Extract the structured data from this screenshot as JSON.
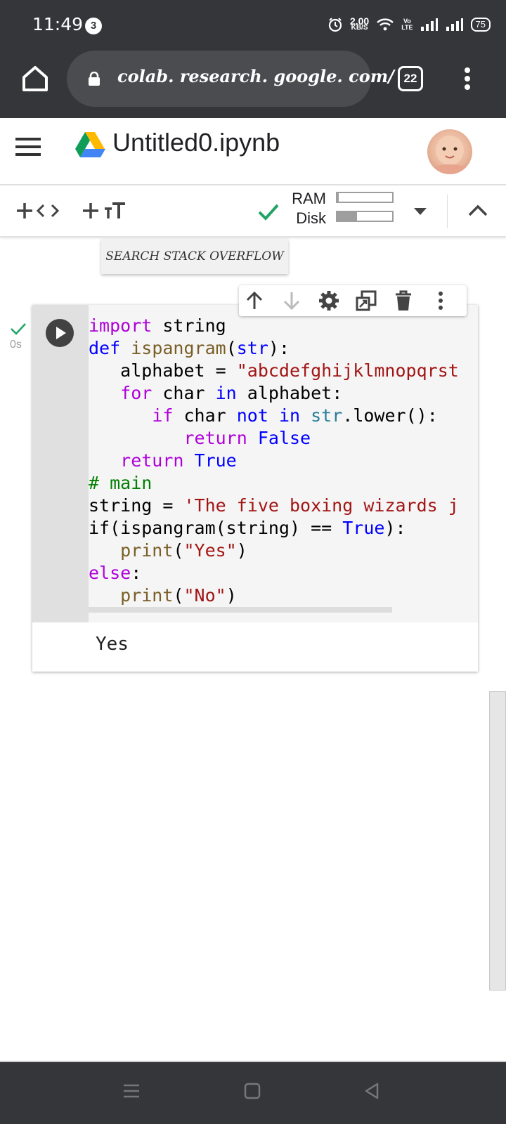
{
  "status_bar": {
    "time": "11:49",
    "notification_count": "3",
    "net_speed_value": "2.00",
    "net_speed_unit": "KB/S",
    "volte_top": "Vo",
    "volte_bottom": "LTE",
    "battery": "75"
  },
  "browser": {
    "url": "colab. research. google. com/",
    "tab_count": "22"
  },
  "header": {
    "notebook_title": "Untitled0.ipynb"
  },
  "toolbar": {
    "ram_label": "RAM",
    "disk_label": "Disk",
    "ram_usage_fraction": 0.03,
    "disk_usage_fraction": 0.36
  },
  "tooltip": {
    "text": "SEARCH STACK OVERFLOW"
  },
  "cell": {
    "exec_time": "0s",
    "code_lines": [
      [
        {
          "t": "import",
          "c": "kw"
        },
        {
          "t": " string",
          "c": ""
        }
      ],
      [
        {
          "t": "def",
          "c": "kw2"
        },
        {
          "t": " ",
          "c": ""
        },
        {
          "t": "ispangram",
          "c": "fn"
        },
        {
          "t": "(",
          "c": ""
        },
        {
          "t": "str",
          "c": "kw2"
        },
        {
          "t": "):",
          "c": ""
        }
      ],
      [
        {
          "t": "   alphabet = ",
          "c": ""
        },
        {
          "t": "\"abcdefghijklmnopqrst",
          "c": "st"
        }
      ],
      [
        {
          "t": "   ",
          "c": ""
        },
        {
          "t": "for",
          "c": "kw"
        },
        {
          "t": " char ",
          "c": ""
        },
        {
          "t": "in",
          "c": "kw2"
        },
        {
          "t": " alphabet:",
          "c": ""
        }
      ],
      [
        {
          "t": "      ",
          "c": ""
        },
        {
          "t": "if",
          "c": "kw"
        },
        {
          "t": " char ",
          "c": ""
        },
        {
          "t": "not",
          "c": "kw2"
        },
        {
          "t": " ",
          "c": ""
        },
        {
          "t": "in",
          "c": "kw2"
        },
        {
          "t": " ",
          "c": ""
        },
        {
          "t": "str",
          "c": "bi"
        },
        {
          "t": ".lower():",
          "c": ""
        }
      ],
      [
        {
          "t": "         ",
          "c": ""
        },
        {
          "t": "return",
          "c": "kw"
        },
        {
          "t": " ",
          "c": ""
        },
        {
          "t": "False",
          "c": "kw2"
        }
      ],
      [
        {
          "t": "   ",
          "c": ""
        },
        {
          "t": "return",
          "c": "kw"
        },
        {
          "t": " ",
          "c": ""
        },
        {
          "t": "True",
          "c": "kw2"
        }
      ],
      [
        {
          "t": "# main",
          "c": "cm"
        }
      ],
      [
        {
          "t": "string = ",
          "c": ""
        },
        {
          "t": "'The five boxing wizards j",
          "c": "st"
        }
      ],
      [
        {
          "t": "if(",
          "c": ""
        },
        {
          "t": "ispangram",
          "c": ""
        },
        {
          "t": "(string) == ",
          "c": ""
        },
        {
          "t": "True",
          "c": "kw2"
        },
        {
          "t": "):",
          "c": ""
        }
      ],
      [
        {
          "t": "   ",
          "c": ""
        },
        {
          "t": "print",
          "c": "fn"
        },
        {
          "t": "(",
          "c": ""
        },
        {
          "t": "\"Yes\"",
          "c": "st"
        },
        {
          "t": ")",
          "c": ""
        }
      ],
      [
        {
          "t": "else",
          "c": "kw"
        },
        {
          "t": ":",
          "c": ""
        }
      ],
      [
        {
          "t": "   ",
          "c": ""
        },
        {
          "t": "print",
          "c": "fn"
        },
        {
          "t": "(",
          "c": ""
        },
        {
          "t": "\"No\"",
          "c": "st"
        },
        {
          "t": ")",
          "c": ""
        }
      ]
    ],
    "output": "Yes"
  },
  "colors": {
    "chrome_bg": "#35363a",
    "check_green": "#21a366",
    "keyword_purple": "#af00db",
    "keyword_blue": "#0000ff",
    "string_red": "#a31515"
  },
  "icons": [
    "home-icon",
    "lock-icon",
    "tabs-icon",
    "more-vert-icon",
    "hamburger-icon",
    "drive-logo",
    "add-code-icon",
    "add-text-icon",
    "check-icon",
    "dropdown-icon",
    "collapse-icon",
    "play-icon",
    "arrow-up-icon",
    "arrow-down-icon",
    "settings-icon",
    "mirror-cell-icon",
    "delete-icon",
    "more-vert-icon",
    "nav-menu-icon",
    "nav-home-icon",
    "nav-back-icon"
  ]
}
